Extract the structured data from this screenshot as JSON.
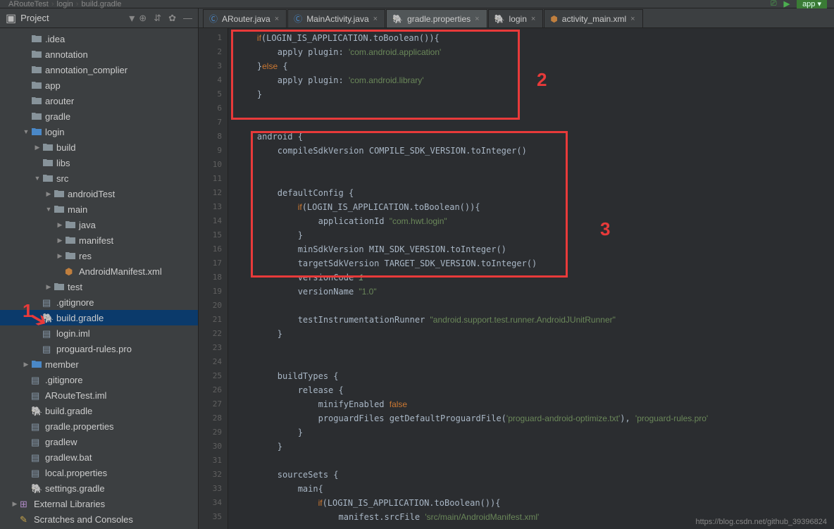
{
  "breadcrumb": {
    "p1": "ARouteTest",
    "p2": "login",
    "p3": "build.gradle"
  },
  "topright": {
    "app": "app",
    "arrow": "▸"
  },
  "sidebar": {
    "title": "Project",
    "tree": [
      {
        "d": 1,
        "a": "",
        "i": "dir",
        "n": ".idea"
      },
      {
        "d": 1,
        "a": "",
        "i": "dir",
        "n": "annotation"
      },
      {
        "d": 1,
        "a": "",
        "i": "dir",
        "n": "annotation_complier"
      },
      {
        "d": 1,
        "a": "",
        "i": "dir",
        "n": "app"
      },
      {
        "d": 1,
        "a": "",
        "i": "dir",
        "n": "arouter"
      },
      {
        "d": 1,
        "a": "",
        "i": "dir",
        "n": "gradle"
      },
      {
        "d": 1,
        "a": "v",
        "i": "mod",
        "n": "login"
      },
      {
        "d": 2,
        "a": "r",
        "i": "dir",
        "n": "build"
      },
      {
        "d": 2,
        "a": "",
        "i": "dir",
        "n": "libs"
      },
      {
        "d": 2,
        "a": "v",
        "i": "dir",
        "n": "src"
      },
      {
        "d": 3,
        "a": "r",
        "i": "dir",
        "n": "androidTest"
      },
      {
        "d": 3,
        "a": "v",
        "i": "dir",
        "n": "main"
      },
      {
        "d": 4,
        "a": "r",
        "i": "dir",
        "n": "java"
      },
      {
        "d": 4,
        "a": "r",
        "i": "dir",
        "n": "manifest"
      },
      {
        "d": 4,
        "a": "r",
        "i": "dir",
        "n": "res"
      },
      {
        "d": 4,
        "a": "",
        "i": "xml",
        "n": "AndroidManifest.xml"
      },
      {
        "d": 3,
        "a": "r",
        "i": "dir",
        "n": "test"
      },
      {
        "d": 2,
        "a": "",
        "i": "file",
        "n": ".gitignore"
      },
      {
        "d": 2,
        "a": "",
        "i": "gradle",
        "n": "build.gradle",
        "sel": true
      },
      {
        "d": 2,
        "a": "",
        "i": "file",
        "n": "login.iml"
      },
      {
        "d": 2,
        "a": "",
        "i": "file",
        "n": "proguard-rules.pro"
      },
      {
        "d": 1,
        "a": "r",
        "i": "mod",
        "n": "member"
      },
      {
        "d": 1,
        "a": "",
        "i": "file",
        "n": ".gitignore"
      },
      {
        "d": 1,
        "a": "",
        "i": "file",
        "n": "ARouteTest.iml"
      },
      {
        "d": 1,
        "a": "",
        "i": "gradle",
        "n": "build.gradle"
      },
      {
        "d": 1,
        "a": "",
        "i": "file",
        "n": "gradle.properties"
      },
      {
        "d": 1,
        "a": "",
        "i": "file",
        "n": "gradlew"
      },
      {
        "d": 1,
        "a": "",
        "i": "file",
        "n": "gradlew.bat"
      },
      {
        "d": 1,
        "a": "",
        "i": "file",
        "n": "local.properties"
      },
      {
        "d": 1,
        "a": "",
        "i": "gradle",
        "n": "settings.gradle"
      },
      {
        "d": 0,
        "a": "r",
        "i": "lib",
        "n": "External Libraries"
      },
      {
        "d": 0,
        "a": "",
        "i": "scratch",
        "n": "Scratches and Consoles"
      }
    ]
  },
  "tabs": [
    {
      "icon": "c",
      "label": "ARouter.java",
      "active": false
    },
    {
      "icon": "c",
      "label": "MainActivity.java",
      "active": false
    },
    {
      "icon": "g",
      "label": "gradle.properties",
      "active": true
    },
    {
      "icon": "g",
      "label": "login",
      "active": false
    },
    {
      "icon": "x",
      "label": "activity_main.xml",
      "active": false
    }
  ],
  "code": {
    "lines": [
      {
        "n": 1,
        "html": "<span class='kw'>if</span>(LOGIN_IS_APPLICATION.toBoolean()){"
      },
      {
        "n": 2,
        "html": "    apply plugin: <span class='str'>'com.android.application'</span>"
      },
      {
        "n": 3,
        "html": "}<span class='kw'>else</span> {"
      },
      {
        "n": 4,
        "html": "    apply plugin: <span class='str'>'com.android.library'</span>"
      },
      {
        "n": 5,
        "html": "}"
      },
      {
        "n": 6,
        "html": ""
      },
      {
        "n": 7,
        "html": ""
      },
      {
        "n": 8,
        "html": "android {"
      },
      {
        "n": 9,
        "html": "    compileSdkVersion COMPILE_SDK_VERSION.toInteger()"
      },
      {
        "n": 10,
        "html": ""
      },
      {
        "n": 11,
        "html": ""
      },
      {
        "n": 12,
        "html": "    defaultConfig {"
      },
      {
        "n": 13,
        "html": "        <span class='kw'>if</span>(LOGIN_IS_APPLICATION.toBoolean()){"
      },
      {
        "n": 14,
        "html": "            applicationId <span class='str'>\"com.hwt.login\"</span>"
      },
      {
        "n": 15,
        "html": "        }"
      },
      {
        "n": 16,
        "html": "        minSdkVersion MIN_SDK_VERSION.toInteger()"
      },
      {
        "n": 17,
        "html": "        targetSdkVersion TARGET_SDK_VERSION.toInteger()"
      },
      {
        "n": 18,
        "html": "        versionCode <span class='str2'>1</span>"
      },
      {
        "n": 19,
        "html": "        versionName <span class='str'>\"1.0\"</span>"
      },
      {
        "n": 20,
        "html": ""
      },
      {
        "n": 21,
        "html": "        testInstrumentationRunner <span class='str'>\"android.support.test.runner.AndroidJUnitRunner\"</span>"
      },
      {
        "n": 22,
        "html": "    }"
      },
      {
        "n": 23,
        "html": ""
      },
      {
        "n": 24,
        "html": ""
      },
      {
        "n": 25,
        "html": "    buildTypes {"
      },
      {
        "n": 26,
        "html": "        release {"
      },
      {
        "n": 27,
        "html": "            minifyEnabled <span class='kw'>false</span>"
      },
      {
        "n": 28,
        "html": "            proguardFiles getDefaultProguardFile(<span class='str'>'proguard-android-optimize.txt'</span>), <span class='str'>'proguard-rules.pro'</span>"
      },
      {
        "n": 29,
        "html": "        }"
      },
      {
        "n": 30,
        "html": "    }"
      },
      {
        "n": 31,
        "html": ""
      },
      {
        "n": 32,
        "html": "    sourceSets {"
      },
      {
        "n": 33,
        "html": "        main{"
      },
      {
        "n": 34,
        "html": "            <span class='kw'>if</span>(LOGIN_IS_APPLICATION.toBoolean()){"
      },
      {
        "n": 35,
        "html": "                manifest.srcFile <span class='str'>'src/main/AndroidManifest.xml'</span>"
      }
    ]
  },
  "annotations": {
    "a1": "1",
    "a2": "2",
    "a3": "3"
  },
  "watermark": "https://blog.csdn.net/github_39396824"
}
